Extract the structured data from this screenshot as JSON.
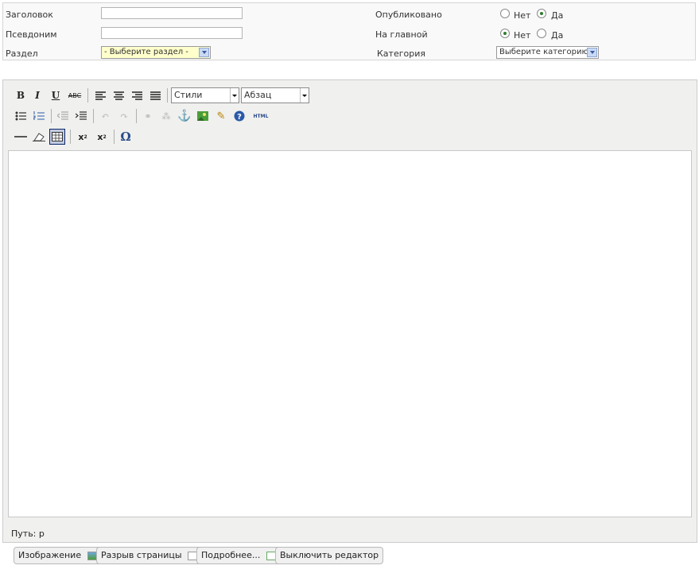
{
  "form": {
    "title_label": "Заголовок",
    "title_value": "",
    "alias_label": "Псевдоним",
    "alias_value": "",
    "section_label": "Раздел",
    "section_selected": "- Выберите раздел -",
    "published_label": "Опубликовано",
    "published_no": "Нет",
    "published_yes": "Да",
    "published_value": "yes",
    "frontpage_label": "На главной",
    "frontpage_no": "Нет",
    "frontpage_yes": "Да",
    "frontpage_value": "no",
    "category_label": "Категория",
    "category_selected": "Выберите категорию"
  },
  "editor": {
    "styles_select": "Стили",
    "format_select": "Абзац",
    "html_button": "HTML",
    "path_text": "Путь: p",
    "content": ""
  },
  "toolbar_icons": {
    "row1": [
      "bold-icon",
      "italic-icon",
      "underline-icon",
      "strikethrough-icon",
      "align-left-icon",
      "align-center-icon",
      "align-right-icon",
      "align-justify-icon"
    ],
    "row2": [
      "bullet-list-icon",
      "numbered-list-icon",
      "outdent-icon",
      "indent-icon",
      "undo-icon",
      "redo-icon",
      "link-icon",
      "unlink-icon",
      "anchor-icon",
      "image-icon",
      "cleanup-icon",
      "help-icon",
      "html-icon"
    ],
    "row3": [
      "horizontal-rule-icon",
      "remove-format-icon",
      "table-icon",
      "subscript-icon",
      "superscript-icon",
      "special-char-icon"
    ]
  },
  "buttons": {
    "image": "Изображение",
    "pagebreak": "Разрыв страницы",
    "readmore": "Подробнее...",
    "toggle_editor": "Выключить редактор"
  },
  "colors": {
    "accent": "#2f7d2f",
    "toolbar_bg": "#f0f0ee",
    "select_highlight": "#ffffcc"
  }
}
